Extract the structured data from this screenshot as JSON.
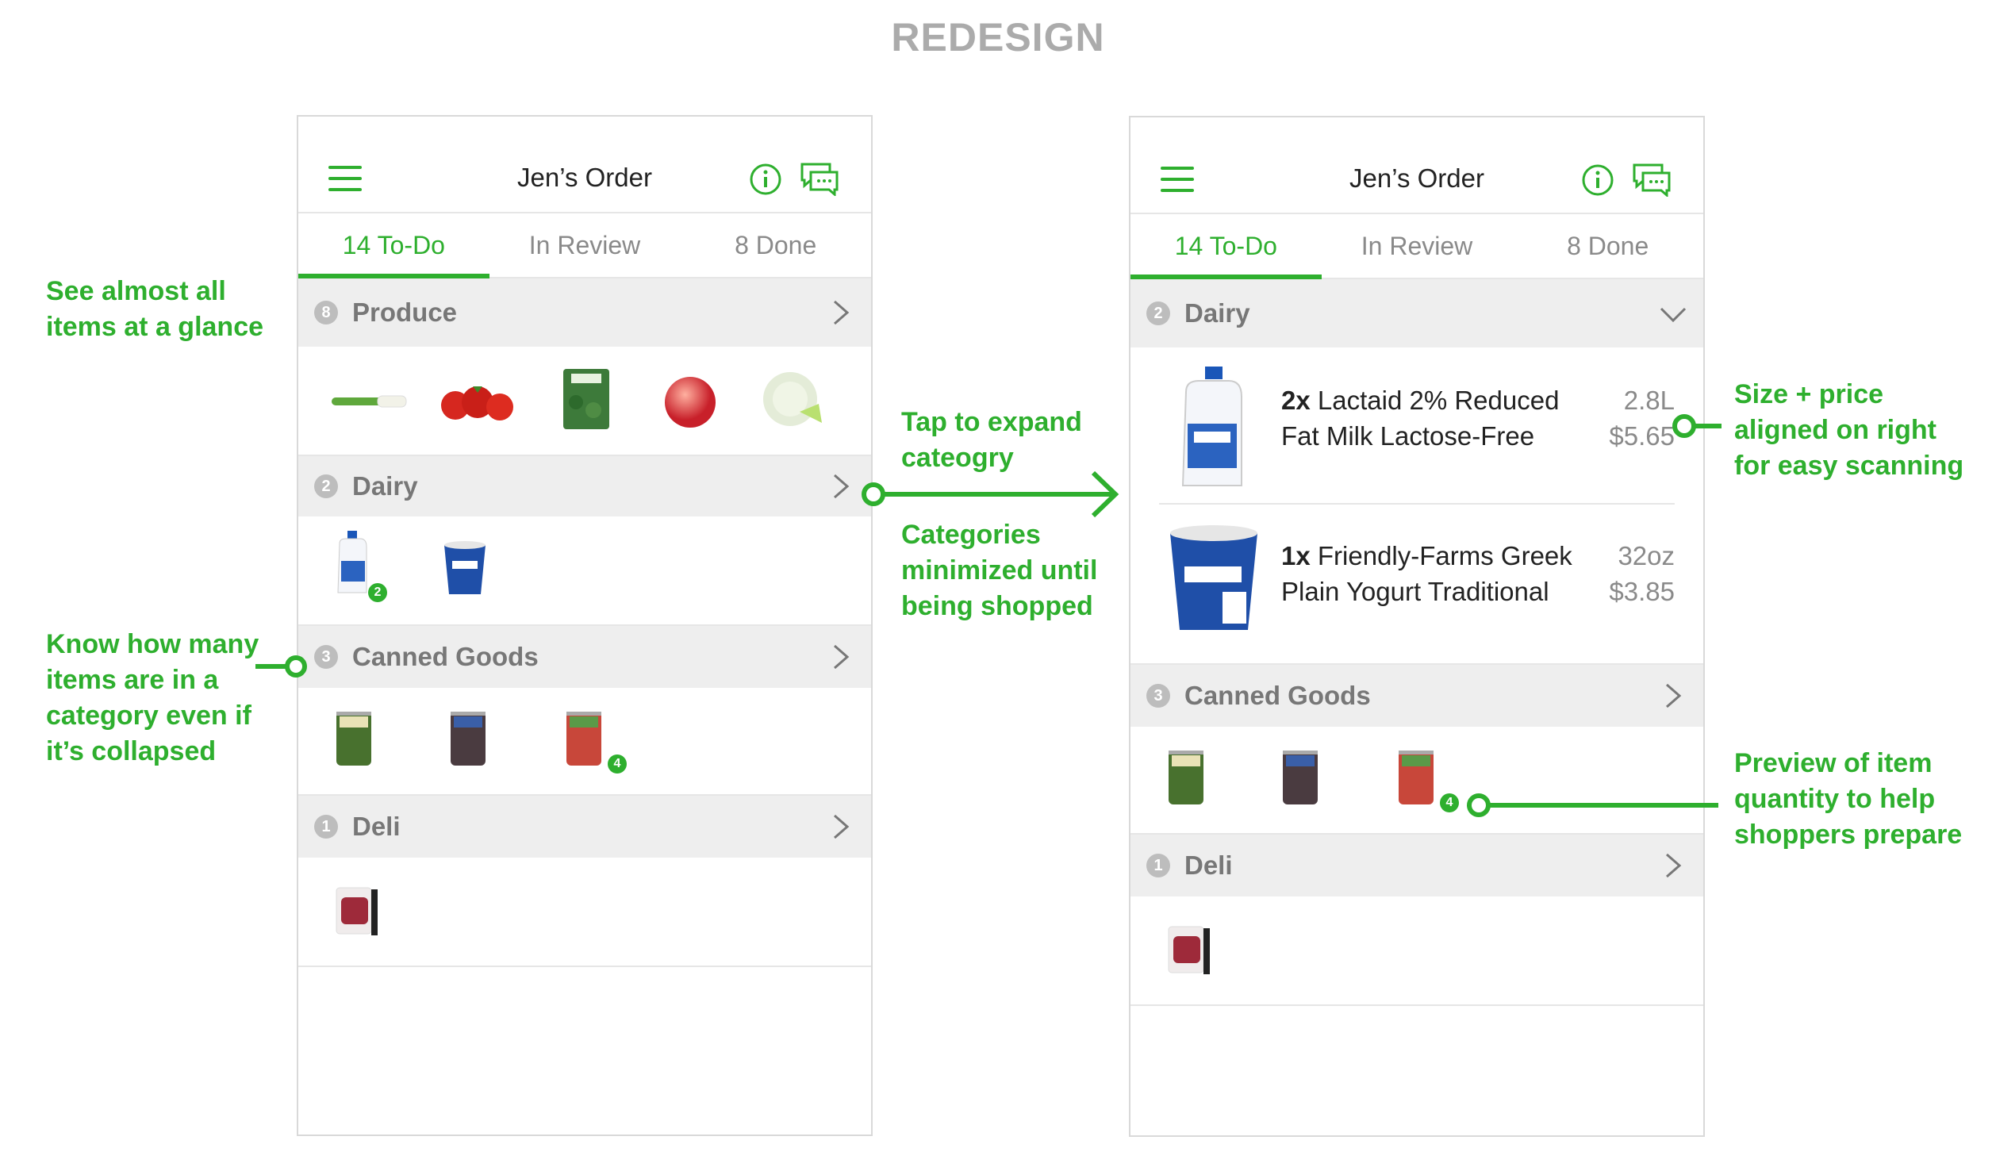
{
  "page_title": "REDESIGN",
  "colors": {
    "accent": "#2eaf2e",
    "header_bg": "#eeeeee",
    "muted": "#8a8a8a"
  },
  "left_phone": {
    "header": {
      "title": "Jen’s Order",
      "menu_icon": "hamburger-icon",
      "info_icon": "info-icon",
      "chat_icon": "chat-icon"
    },
    "tabs": [
      {
        "label": "14 To-Do",
        "active": true
      },
      {
        "label": "In Review"
      },
      {
        "label": "8 Done"
      }
    ],
    "categories": [
      {
        "count": "8",
        "name": "Produce",
        "items": [
          "green onion",
          "tomatoes",
          "spinach",
          "peach",
          "cabbage"
        ]
      },
      {
        "count": "2",
        "name": "Dairy",
        "items": [
          "milk jug",
          "greek yogurt"
        ],
        "badge_qty": "2"
      },
      {
        "count": "3",
        "name": "Canned Goods",
        "items": [
          "green beans can",
          "black beans can",
          "tomato can"
        ],
        "badge_qty": "4"
      },
      {
        "count": "1",
        "name": "Deli",
        "items": [
          "deli meat"
        ]
      }
    ]
  },
  "right_phone": {
    "header": {
      "title": "Jen’s Order"
    },
    "tabs": [
      {
        "label": "14 To-Do",
        "active": true
      },
      {
        "label": "In Review"
      },
      {
        "label": "8 Done"
      }
    ],
    "dairy": {
      "count": "2",
      "name": "Dairy",
      "items": [
        {
          "qty": "2x",
          "name_line1": "Lactaid 2% Reduced",
          "name_line2": "Fat Milk Lactose-Free",
          "size": "2.8L",
          "price": "$5.65"
        },
        {
          "qty": "1x",
          "name_line1": "Friendly-Farms Greek",
          "name_line2": "Plain Yogurt Traditional",
          "size": "32oz",
          "price": "$3.85"
        }
      ]
    },
    "canned": {
      "count": "3",
      "name": "Canned Goods",
      "badge_qty": "4"
    },
    "deli": {
      "count": "1",
      "name": "Deli"
    }
  },
  "annotations": {
    "glance_l1": "See almost all",
    "glance_l2": "items at a glance",
    "howmany_l1": "Know how many",
    "howmany_l2": "items are in a",
    "howmany_l3": "category even if",
    "howmany_l4": "it’s collapsed",
    "tap_l1": "Tap to expand",
    "tap_l2": "cateogry",
    "minimized_l1": "Categories",
    "minimized_l2": "minimized until",
    "minimized_l3": "being shopped",
    "size_l1": "Size + price",
    "size_l2": "aligned on right",
    "size_l3": "for easy scanning",
    "preview_l1": "Preview of item",
    "preview_l2": "quantity to help",
    "preview_l3": "shoppers prepare"
  }
}
